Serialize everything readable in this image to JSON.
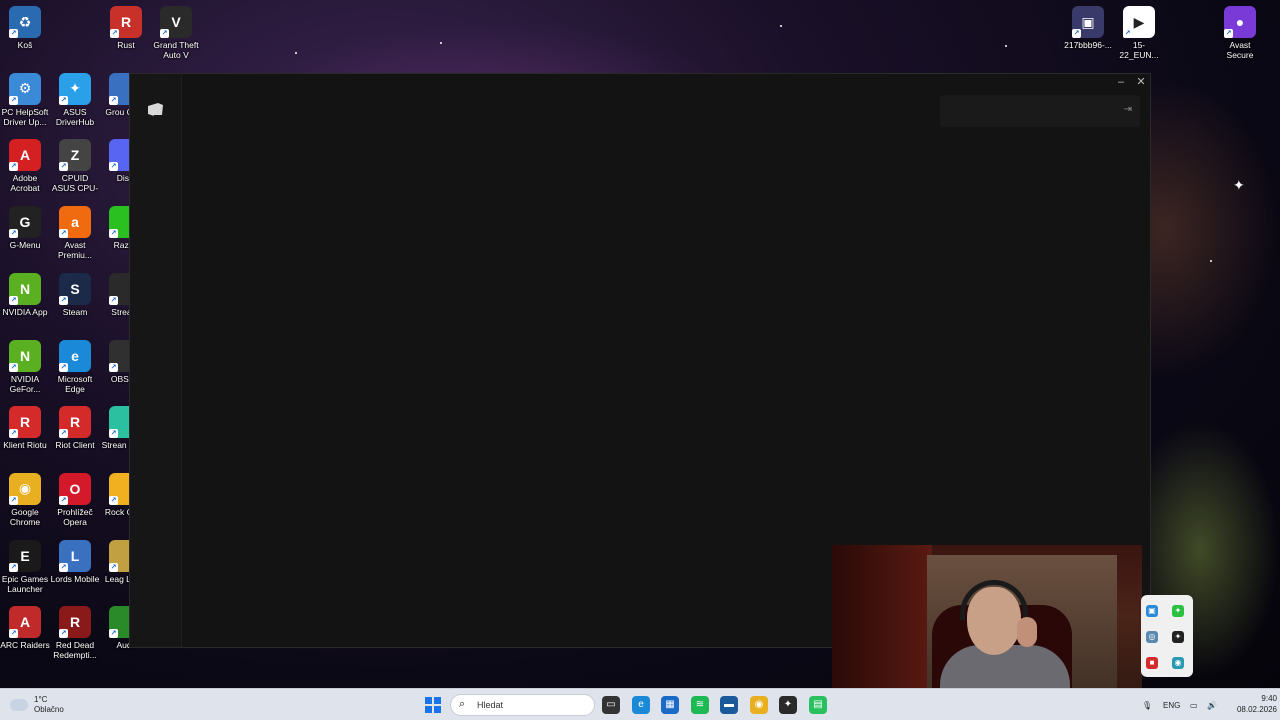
{
  "desktop": {
    "left_icons": [
      {
        "label": "Koš",
        "color": "#2a6ab0",
        "glyph": "♻",
        "col": 0,
        "row": 0
      },
      {
        "label": "PC HelpSoft Driver Up...",
        "color": "#3a8ad8",
        "glyph": "⚙",
        "col": 0,
        "row": 1
      },
      {
        "label": "ASUS DriverHub",
        "color": "#2aa0e8",
        "glyph": "✦",
        "col": 1,
        "row": 1
      },
      {
        "label": "Adobe Acrobat",
        "color": "#d42020",
        "glyph": "A",
        "col": 0,
        "row": 2
      },
      {
        "label": "CPUID ASUS CPU-Z",
        "color": "#444444",
        "glyph": "Z",
        "col": 1,
        "row": 2
      },
      {
        "label": "G-Menu",
        "color": "#222222",
        "glyph": "G",
        "col": 0,
        "row": 3
      },
      {
        "label": "Avast Premiu...",
        "color": "#f06a10",
        "glyph": "a",
        "col": 1,
        "row": 3
      },
      {
        "label": "NVIDIA App",
        "color": "#5ab020",
        "glyph": "N",
        "col": 0,
        "row": 4
      },
      {
        "label": "Steam",
        "color": "#1a2a48",
        "glyph": "S",
        "col": 1,
        "row": 4
      },
      {
        "label": "NVIDIA GeFor...",
        "color": "#5ab020",
        "glyph": "N",
        "col": 0,
        "row": 5
      },
      {
        "label": "Microsoft Edge",
        "color": "#1a8ad8",
        "glyph": "e",
        "col": 1,
        "row": 5
      },
      {
        "label": "Klient Riotu",
        "color": "#d42a2a",
        "glyph": "R",
        "col": 0,
        "row": 6
      },
      {
        "label": "Riot Client",
        "color": "#d42a2a",
        "glyph": "R",
        "col": 1,
        "row": 6
      },
      {
        "label": "Google Chrome",
        "color": "#e8b020",
        "glyph": "◉",
        "col": 0,
        "row": 7
      },
      {
        "label": "Prohlížeč Opera",
        "color": "#d41a2a",
        "glyph": "O",
        "col": 1,
        "row": 7
      },
      {
        "label": "Epic Games Launcher",
        "color": "#1a1a1a",
        "glyph": "E",
        "col": 0,
        "row": 8
      },
      {
        "label": "Lords Mobile",
        "color": "#3a70c0",
        "glyph": "L",
        "col": 1,
        "row": 8
      },
      {
        "label": "ARC Raiders",
        "color": "#c02a2a",
        "glyph": "A",
        "col": 0,
        "row": 9
      },
      {
        "label": "Red Dead Redempti...",
        "color": "#8a1a1a",
        "glyph": "R",
        "col": 1,
        "row": 9
      }
    ],
    "partial_icons": [
      {
        "label": "Grou Com",
        "color": "#3a70c0",
        "row": 1
      },
      {
        "label": "Disc",
        "color": "#5865f2",
        "row": 2
      },
      {
        "label": "Razer",
        "color": "#2ac020",
        "row": 3
      },
      {
        "label": "Stream",
        "color": "#2a2a2a",
        "row": 4
      },
      {
        "label": "OBS St",
        "color": "#303030",
        "row": 5
      },
      {
        "label": "Strean Desk",
        "color": "#2ac0a0",
        "row": 6
      },
      {
        "label": "Rock Gam",
        "color": "#f0b020",
        "row": 7
      },
      {
        "label": "Leag Lege",
        "color": "#c0a040",
        "row": 8
      },
      {
        "label": "Audi",
        "color": "#2a8a2a",
        "row": 9
      }
    ],
    "top_icons": [
      {
        "label": "Rust",
        "color": "#c8302a",
        "glyph": "R"
      },
      {
        "label": "Grand Theft Auto V",
        "color": "#2a2a2a",
        "glyph": "V"
      }
    ],
    "right_icons": [
      {
        "label": "217bbb96-...",
        "color": "#3a3a6a",
        "glyph": "▣"
      },
      {
        "label": "15-22_EUN...",
        "color": "#ffffff",
        "glyph": "▶"
      },
      {
        "label": "Avast Secure Browser",
        "color": "#7a3ad8",
        "glyph": "●"
      }
    ]
  },
  "window": {
    "minimize_label": "–",
    "close_label": "✕",
    "collapse_label": "⇥"
  },
  "taskbar": {
    "weather_temp": "1°C",
    "weather_desc": "Oblačno",
    "search_placeholder": "Hledat",
    "language": "ENG",
    "time": "9:40",
    "date": "08.02.2026",
    "apps": [
      {
        "name": "task-view",
        "color": "#333333",
        "glyph": "▭"
      },
      {
        "name": "edge",
        "color": "#1a8ad8",
        "glyph": "e"
      },
      {
        "name": "store",
        "color": "#1a6ac8",
        "glyph": "▦"
      },
      {
        "name": "spotify",
        "color": "#1db954",
        "glyph": "≋"
      },
      {
        "name": "desktop-app",
        "color": "#1a5a9a",
        "glyph": "▬"
      },
      {
        "name": "chrome",
        "color": "#e8b020",
        "glyph": "◉"
      },
      {
        "name": "riot",
        "color": "#2a2a2a",
        "glyph": "✦"
      },
      {
        "name": "android",
        "color": "#2ac060",
        "glyph": "▤"
      }
    ]
  }
}
